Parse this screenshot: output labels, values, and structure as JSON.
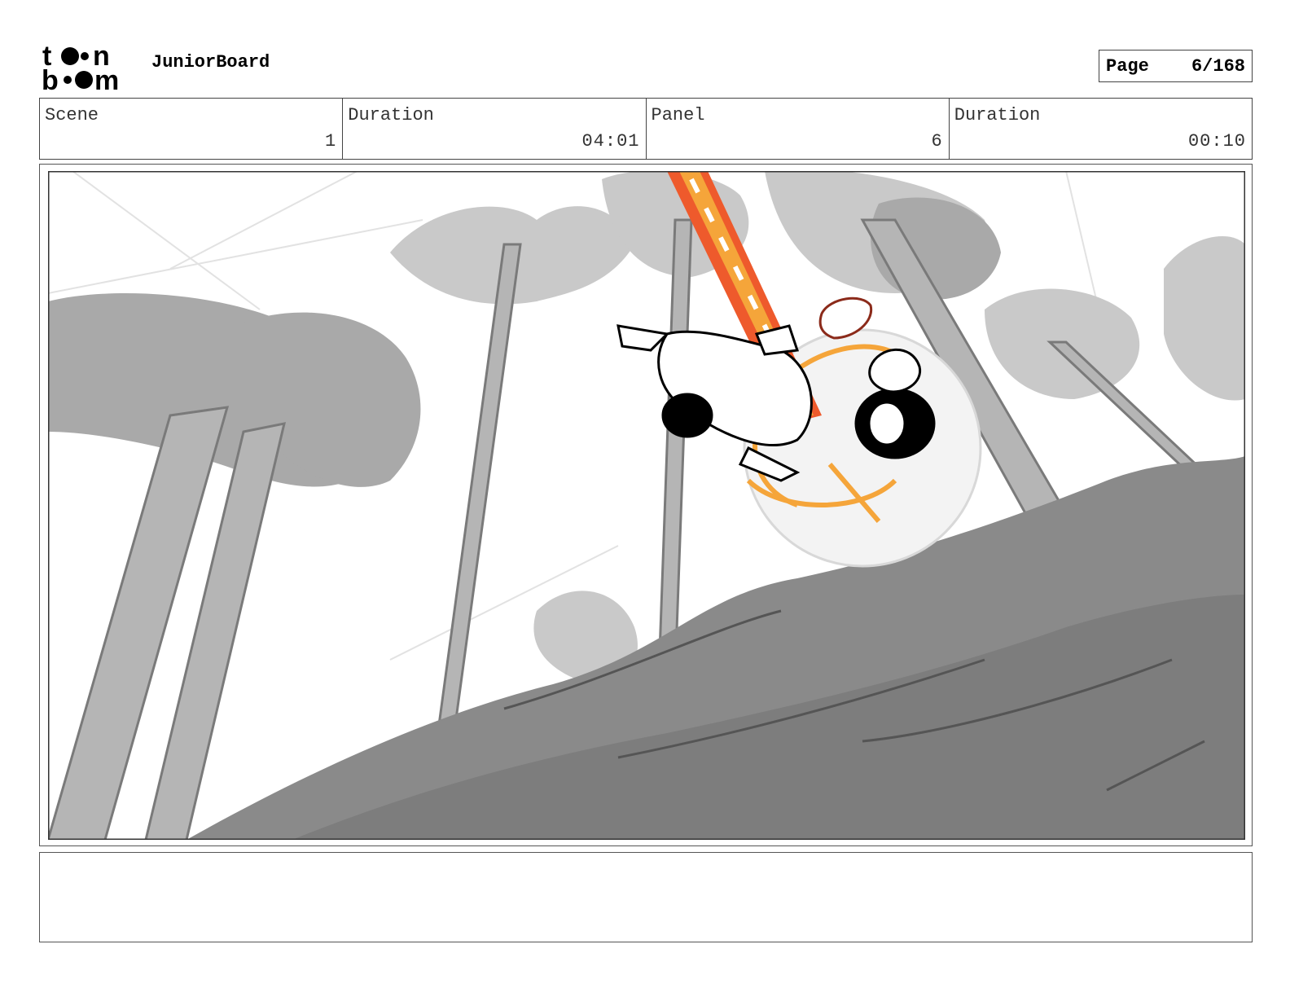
{
  "header": {
    "logo_text_top": "toon",
    "logo_text_bottom": "boom",
    "project_title": "JuniorBoard",
    "page_label": "Page",
    "page_value": "6/168"
  },
  "info": {
    "scene_label": "Scene",
    "scene_value": "1",
    "scene_duration_label": "Duration",
    "scene_duration_value": "04:01",
    "panel_label": "Panel",
    "panel_value": "6",
    "panel_duration_label": "Duration",
    "panel_duration_value": "00:10"
  },
  "panel": {
    "accent_orange": "#f5a53a",
    "accent_red": "#ee5a2c",
    "sketch_gray": "#9a9a9a",
    "ground_gray": "#7d7d7d"
  },
  "notes": {
    "text": ""
  }
}
